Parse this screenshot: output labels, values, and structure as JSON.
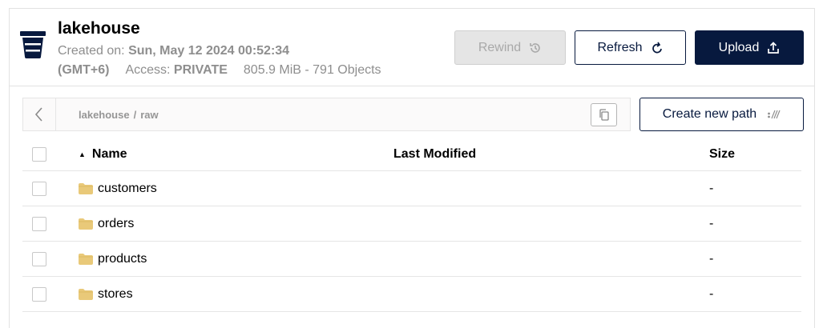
{
  "bucket": {
    "name": "lakehouse",
    "created_label": "Created on:",
    "created_value": "Sun, May 12 2024 00:52:34",
    "timezone": "(GMT+6)",
    "access_label": "Access:",
    "access_value": "PRIVATE",
    "usage": "805.9 MiB - 791 Objects"
  },
  "actions": {
    "rewind": "Rewind",
    "refresh": "Refresh",
    "upload": "Upload",
    "create_path": "Create new path"
  },
  "path": {
    "crumbs": [
      "lakehouse",
      "raw"
    ],
    "separator": "/"
  },
  "table": {
    "headers": {
      "name": "Name",
      "modified": "Last Modified",
      "size": "Size"
    },
    "rows": [
      {
        "name": "customers",
        "modified": "",
        "size": "-"
      },
      {
        "name": "orders",
        "modified": "",
        "size": "-"
      },
      {
        "name": "products",
        "modified": "",
        "size": "-"
      },
      {
        "name": "stores",
        "modified": "",
        "size": "-"
      }
    ]
  },
  "colors": {
    "primary": "#07193e",
    "muted_text": "#8e8e8e",
    "folder": "#e9c979"
  },
  "icons": {
    "bucket": "bucket-icon",
    "rewind": "history-icon",
    "refresh": "refresh-icon",
    "upload": "upload-icon",
    "back": "chevron-left-icon",
    "copy": "copy-icon",
    "new_path": "new-path-icon",
    "folder": "folder-icon",
    "sort": "sort-asc-icon"
  }
}
